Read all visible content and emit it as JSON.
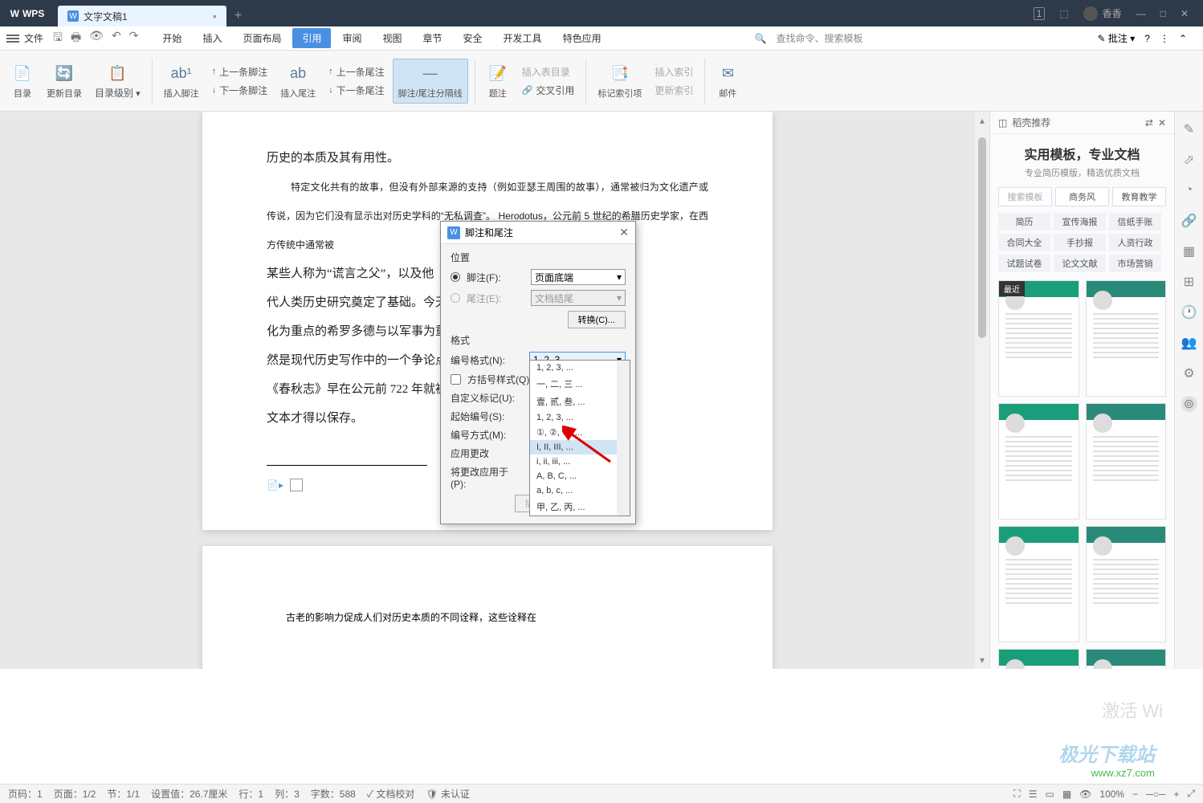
{
  "titlebar": {
    "logo": "WPS",
    "tab": "文字文稿1",
    "user": "香香"
  },
  "menubar": {
    "file": "文件",
    "items": [
      "开始",
      "插入",
      "页面布局",
      "引用",
      "审阅",
      "视图",
      "章节",
      "安全",
      "开发工具",
      "特色应用"
    ],
    "active": 3,
    "search": "查找命令、搜索模板",
    "comment": "批注"
  },
  "ribbon": {
    "catalog": "目录",
    "update_catalog": "更新目录",
    "catalog_level": "目录级别",
    "insert_footnote": "插入脚注",
    "prev_footnote": "上一条脚注",
    "next_footnote": "下一条脚注",
    "insert_endnote": "插入尾注",
    "prev_endnote": "上一条尾注",
    "next_endnote": "下一条尾注",
    "separator": "脚注/尾注分隔线",
    "caption": "题注",
    "insert_table_catalog": "插入表目录",
    "cross_ref": "交叉引用",
    "mark_index": "标记索引项",
    "insert_index": "插入索引",
    "update_index": "更新索引",
    "mail": "邮件"
  },
  "document": {
    "p1": "历史的本质及其有用性。",
    "p2": "特定文化共有的故事，但没有外部来源的支持（例如亚瑟王周围的故事），通常被归为文化遗产或传说，因为它们没有显示出对历史学科的“无私调查”。 Herodotus，公元前 5 世纪的希腊历史学家，在西方传统中通常被",
    "p3": "某些人称为“谎言之父”，以及他",
    "p4": "代人类历史研究奠定了基础。今天",
    "p5": "化为重点的希罗多德与以军事为重",
    "p6": "然是现代历史写作中的一个争论点",
    "p7": "《春秋志》早在公元前 722 年就被",
    "p8": "文本才得以保存。",
    "p9": "古老的影响力促成人们对历史本质的不同诠释，这些诠释在"
  },
  "dialog": {
    "title": "脚注和尾注",
    "position": "位置",
    "footnote": "脚注(F):",
    "endnote": "尾注(E):",
    "page_bottom": "页面底端",
    "doc_end": "文档结尾",
    "convert": "转换(C)...",
    "format": "格式",
    "num_format": "编号格式(N):",
    "bracket": "方括号样式(Q):",
    "custom": "自定义标记(U):",
    "start_num": "起始编号(S):",
    "num_method": "编号方式(M):",
    "apply_change": "应用更改",
    "apply_to": "将更改应用于(P):",
    "insert": "插入(I)",
    "selected": "1, 2, 3, ..."
  },
  "dropdown": {
    "items": [
      "1, 2, 3, ...",
      "一, 二, 三 ...",
      "壹, 贰, 叁, ...",
      "1,  2,  3, ...",
      "①, ②, ③, ...",
      "I, II, III, ...",
      "i, ii, iii, ...",
      "A, B, C, ...",
      "a, b, c, ...",
      "甲, 乙, 丙, ..."
    ],
    "hover": 5
  },
  "sidepanel": {
    "header": "稻壳推荐",
    "title": "实用模板，专业文档",
    "sub": "专业简历模版，精选优质文档",
    "filter": [
      "搜索模板",
      "商务风",
      "教育教学"
    ],
    "tags": [
      "简历",
      "宣传海报",
      "信纸手账",
      "合同大全",
      "手抄报",
      "人资行政",
      "试题试卷",
      "论文文献",
      "市场营销"
    ],
    "recent": "最近"
  },
  "statusbar": {
    "page_num": "页码：1",
    "page": "页面：1/2",
    "section": "节：1/1",
    "pos": "设置值：26.7厘米",
    "line": "行：1",
    "col": "列：3",
    "words": "字数：588",
    "proof": "文档校对",
    "unauth": "未认证",
    "zoom": "100%"
  },
  "watermark": {
    "brand": "极光下载站",
    "url": "www.xz7.com"
  },
  "activate": "激活 Wi"
}
